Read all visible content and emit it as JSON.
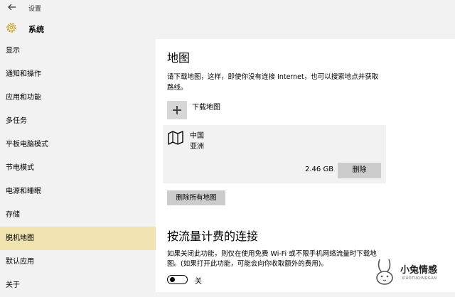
{
  "window": {
    "title": "设置"
  },
  "header": {
    "title": "系统"
  },
  "sidebar": {
    "items": [
      {
        "label": "显示"
      },
      {
        "label": "通知和操作"
      },
      {
        "label": "应用和功能"
      },
      {
        "label": "多任务"
      },
      {
        "label": "平板电脑模式"
      },
      {
        "label": "节电模式"
      },
      {
        "label": "电源和睡眠"
      },
      {
        "label": "存储"
      },
      {
        "label": "脱机地图",
        "active": true
      },
      {
        "label": "默认应用"
      },
      {
        "label": "关于"
      }
    ]
  },
  "main": {
    "maps_heading": "地图",
    "maps_description": "请下载地图，这样，即使你没有连接 Internet，也可以搜索地点并获取路线。",
    "download_label": "下载地图",
    "downloaded_map": {
      "region": "中国",
      "continent": "亚洲",
      "size": "2.46 GB",
      "delete_label": "删除"
    },
    "delete_all_label": "删除所有地图",
    "metered_heading": "按流量计费的连接",
    "metered_description": "如果关闭此功能，则仅在使用免费 Wi-Fi 或不限手机网络流量时下载地图。(如果打开此功能，可能会向你收取额外的费用)。",
    "metered_toggle_state": "关"
  },
  "watermark": {
    "title": "小兔情感",
    "subtitle": "XIAOTUQINGGAN"
  },
  "colors": {
    "active_item_bg": "#f0e3b0",
    "button_bg": "#cccccc"
  }
}
